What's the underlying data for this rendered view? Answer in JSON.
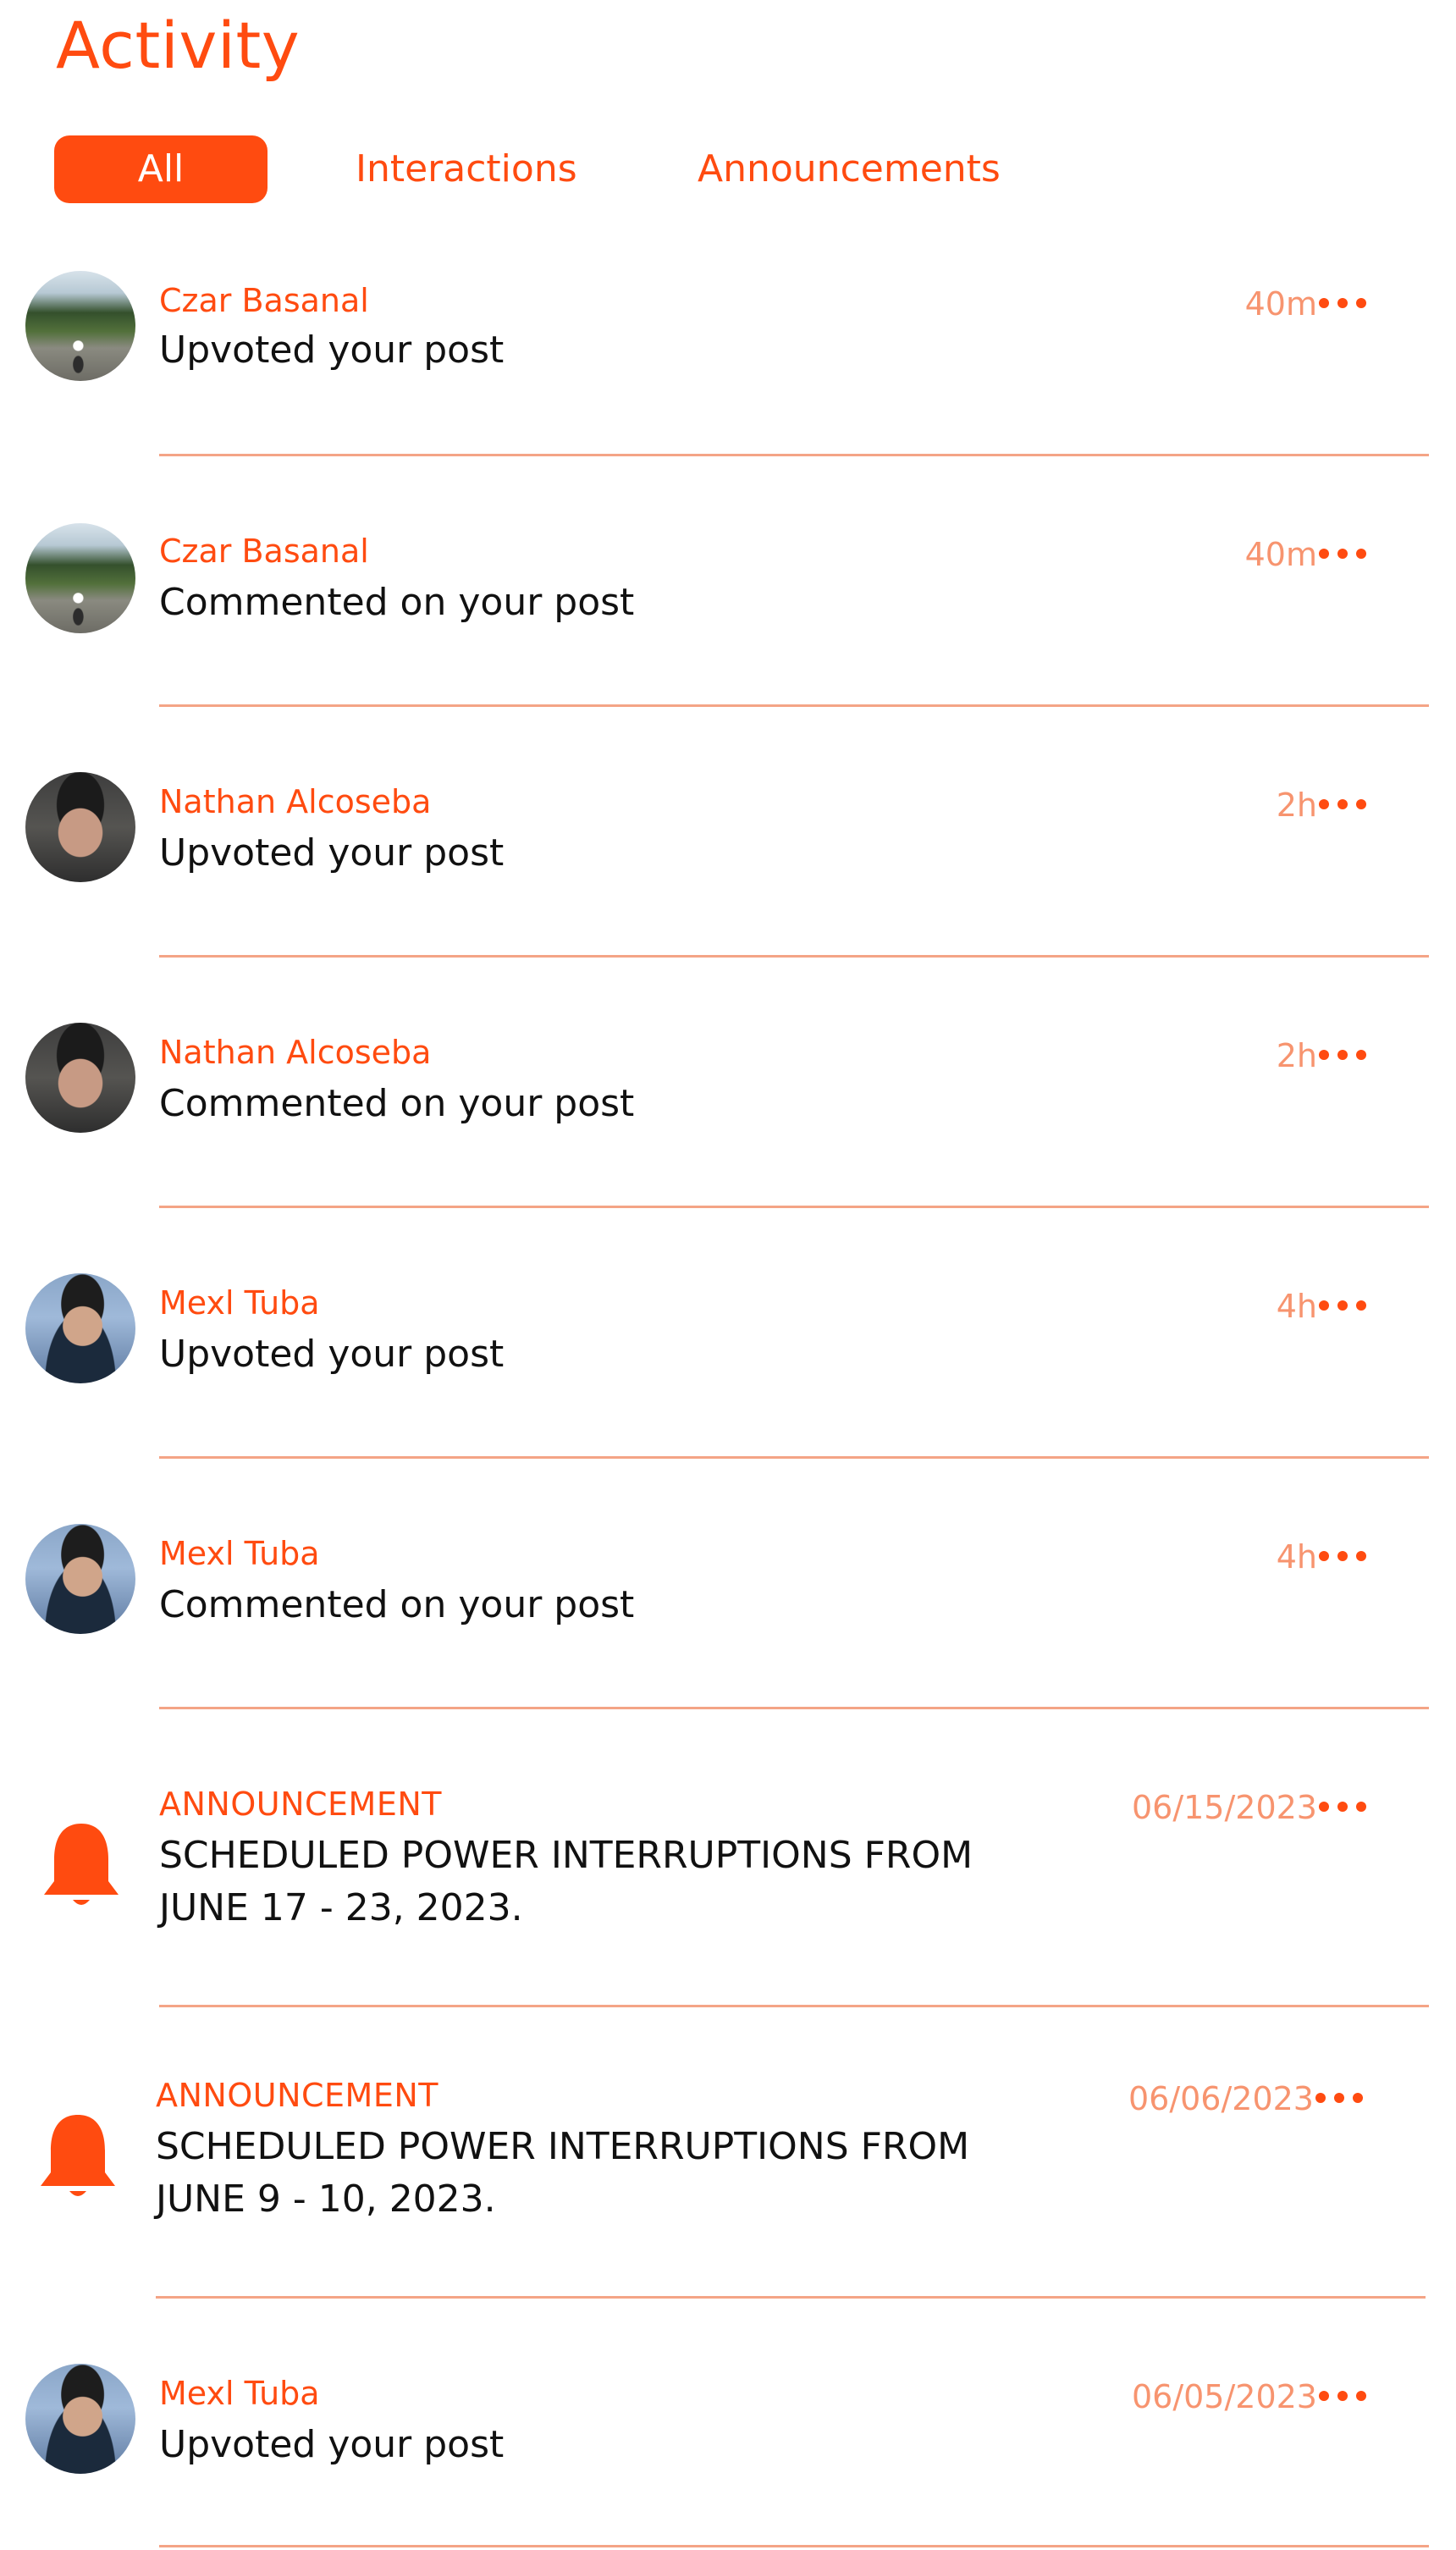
{
  "header": {
    "title": "Activity"
  },
  "tabs": [
    {
      "label": "All",
      "active": true
    },
    {
      "label": "Interactions",
      "active": false
    },
    {
      "label": "Announcements",
      "active": false
    }
  ],
  "colors": {
    "accent": "#ff4b10",
    "time": "#f7946f",
    "divider": "#f4a486",
    "text": "#111111"
  },
  "feed": [
    {
      "kind": "user",
      "avatar": "avatar-czar",
      "name": "Czar Basanal",
      "message": "Upvoted your post",
      "time": "40m"
    },
    {
      "kind": "user",
      "avatar": "avatar-czar",
      "name": "Czar Basanal",
      "message": "Commented on your post",
      "time": "40m"
    },
    {
      "kind": "user",
      "avatar": "avatar-nathan",
      "name": "Nathan Alcoseba",
      "message": "Upvoted your post",
      "time": "2h"
    },
    {
      "kind": "user",
      "avatar": "avatar-nathan",
      "name": "Nathan Alcoseba",
      "message": "Commented on your post",
      "time": "2h"
    },
    {
      "kind": "user",
      "avatar": "avatar-mexl",
      "name": "Mexl Tuba",
      "message": "Upvoted your post",
      "time": "4h"
    },
    {
      "kind": "user",
      "avatar": "avatar-mexl",
      "name": "Mexl Tuba",
      "message": "Commented on your post",
      "time": "4h"
    },
    {
      "kind": "announcement",
      "icon": "bell-icon",
      "name": "ANNOUNCEMENT",
      "message_line1": "SCHEDULED POWER INTERRUPTIONS FROM",
      "message_line2": "JUNE 17 - 23, 2023.",
      "time": "06/15/2023"
    },
    {
      "kind": "announcement",
      "icon": "bell-icon",
      "name": "ANNOUNCEMENT",
      "message_line1": "SCHEDULED POWER INTERRUPTIONS FROM",
      "message_line2": "JUNE 9 - 10, 2023.",
      "time": "06/06/2023"
    },
    {
      "kind": "user",
      "avatar": "avatar-mexl",
      "name": "Mexl Tuba",
      "message": "Upvoted your post",
      "time": "06/05/2023"
    }
  ]
}
